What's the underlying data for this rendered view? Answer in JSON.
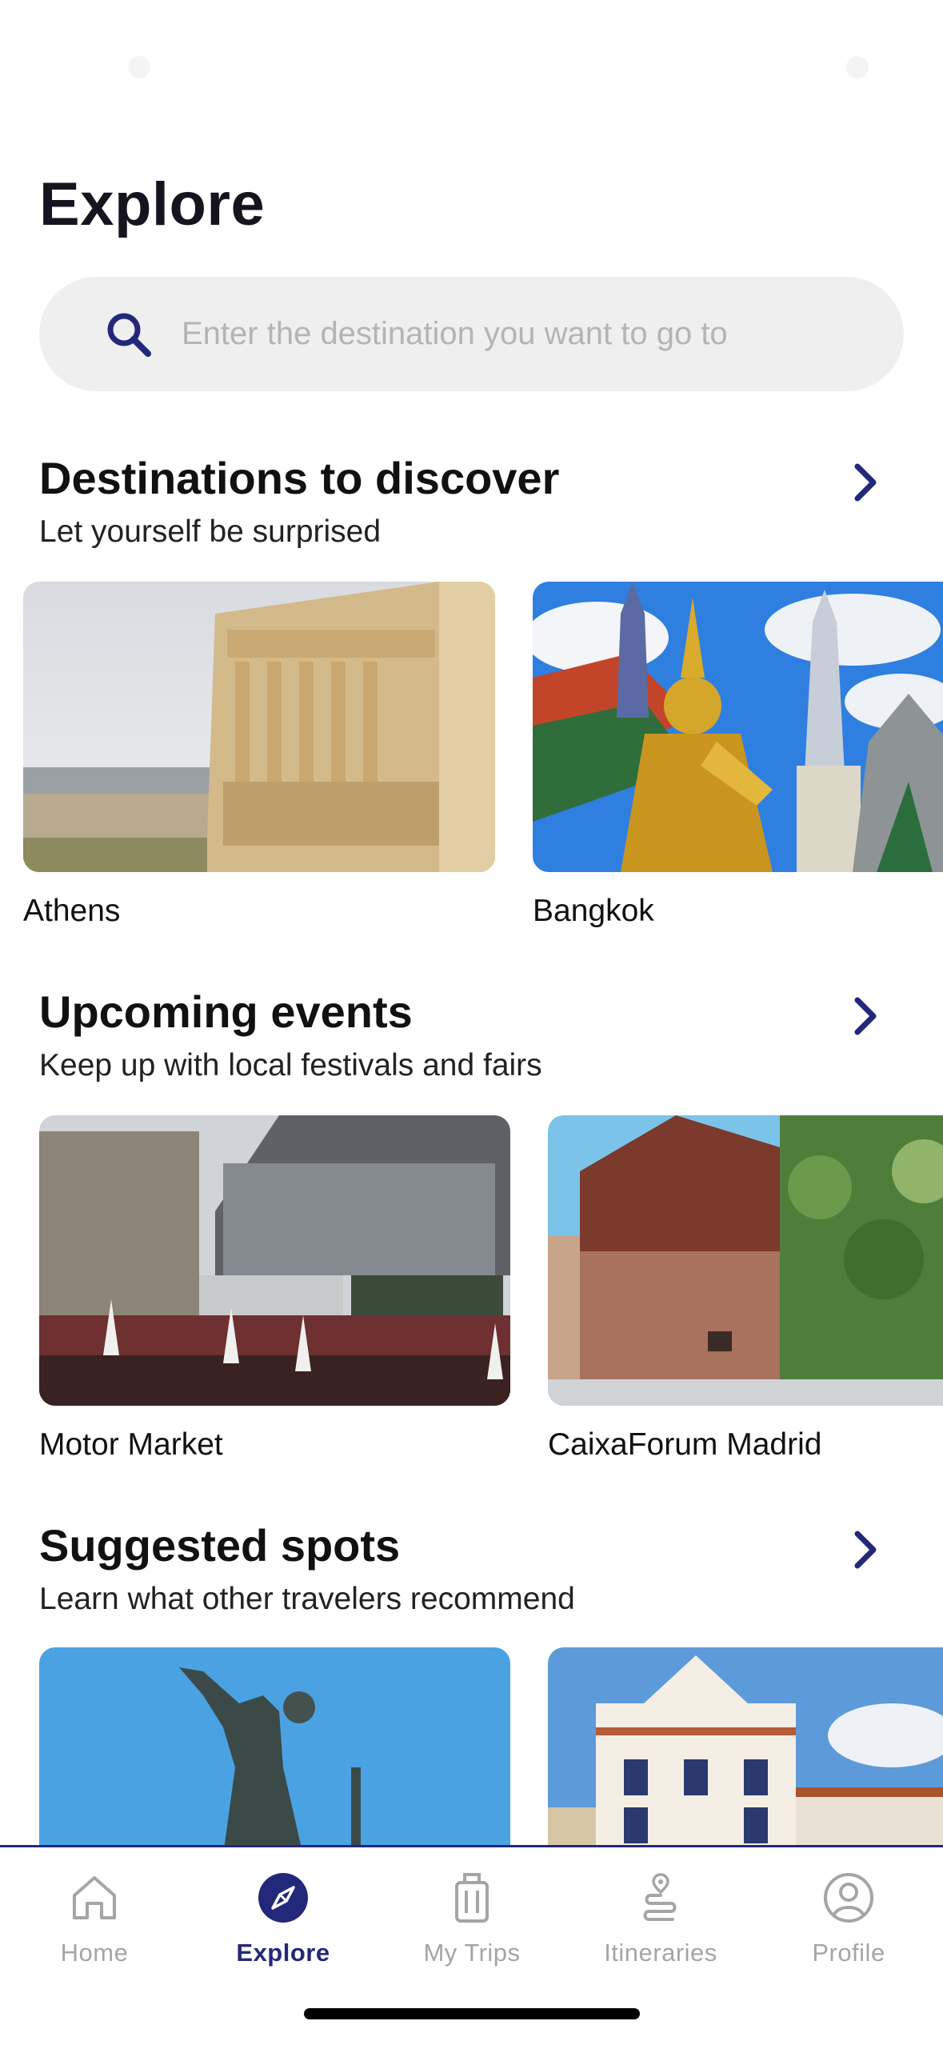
{
  "header": {
    "title": "Explore"
  },
  "search": {
    "placeholder": "Enter the destination you want to go to"
  },
  "sections": [
    {
      "title": "Destinations to discover",
      "subtitle": "Let yourself be surprised",
      "cards": [
        {
          "label": "Athens"
        },
        {
          "label": "Bangkok"
        }
      ]
    },
    {
      "title": "Upcoming events",
      "subtitle": "Keep up with local festivals and fairs",
      "cards": [
        {
          "label": "Motor Market"
        },
        {
          "label": "CaixaForum Madrid"
        }
      ]
    },
    {
      "title": "Suggested spots",
      "subtitle": "Learn what other travelers recommend",
      "cards": [
        {
          "label": ""
        },
        {
          "label": ""
        }
      ]
    }
  ],
  "tabbar": {
    "active": "Explore",
    "items": [
      {
        "label": "Home",
        "icon": "home-icon"
      },
      {
        "label": "Explore",
        "icon": "compass-icon"
      },
      {
        "label": "My Trips",
        "icon": "suitcase-icon"
      },
      {
        "label": "Itineraries",
        "icon": "route-icon"
      },
      {
        "label": "Profile",
        "icon": "user-icon"
      }
    ]
  },
  "colors": {
    "accent": "#23287a",
    "inactive": "#a5a5a5",
    "search_bg": "#efefef"
  }
}
